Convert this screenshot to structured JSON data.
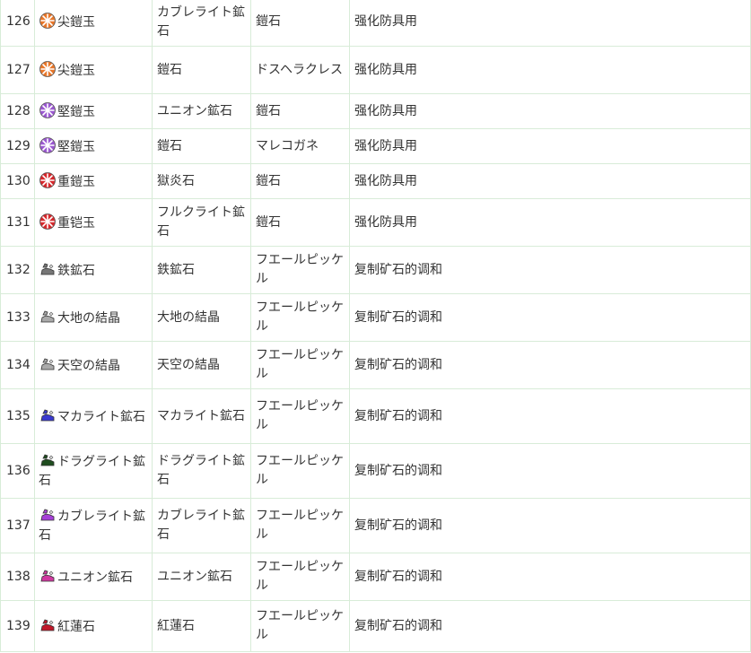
{
  "rows": [
    {
      "no": "126",
      "icon": "orange-spike-gem-icon",
      "icon_color": "#e8772a",
      "name": "尖鎧玉",
      "a": "カブレライト鉱石",
      "b": "鎧石",
      "use": "强化防具用",
      "h": 54
    },
    {
      "no": "127",
      "icon": "orange-spike-gem-icon",
      "icon_color": "#e8772a",
      "name": "尖鎧玉",
      "a": "鎧石",
      "b": "ドスヘラクレス",
      "use": "强化防具用",
      "h": 53
    },
    {
      "no": "128",
      "icon": "purple-spike-gem-icon",
      "icon_color": "#9b59d0",
      "name": "堅鎧玉",
      "a": "ユニオン鉱石",
      "b": "鎧石",
      "use": "强化防具用",
      "h": 39
    },
    {
      "no": "129",
      "icon": "purple-spike-gem-icon",
      "icon_color": "#9b59d0",
      "name": "堅鎧玉",
      "a": "鎧石",
      "b": "マレコガネ",
      "use": "强化防具用",
      "h": 39
    },
    {
      "no": "130",
      "icon": "red-spike-gem-icon",
      "icon_color": "#d6282c",
      "name": "重鎧玉",
      "a": "獄炎石",
      "b": "鎧石",
      "use": "强化防具用",
      "h": 39
    },
    {
      "no": "131",
      "icon": "red-spike-gem-icon",
      "icon_color": "#d6282c",
      "name": "重铠玉",
      "a": "フルクライト鉱石",
      "b": "鎧石",
      "use": "强化防具用",
      "h": 53
    },
    {
      "no": "132",
      "icon": "gray-ore-icon",
      "icon_color": "#777777",
      "name": "鉄鉱石",
      "a": "鉄鉱石",
      "b": "フエールピッケル",
      "use": "复制矿石的调和",
      "h": 53
    },
    {
      "no": "133",
      "icon": "light-gray-ore-icon",
      "icon_color": "#aaaaaa",
      "name": "大地の結晶",
      "a": "大地の結晶",
      "b": "フエールピッケル",
      "use": "复制矿石的调和",
      "h": 53
    },
    {
      "no": "134",
      "icon": "light-gray-ore-icon",
      "icon_color": "#aaaaaa",
      "name": "天空の結晶",
      "a": "天空の結晶",
      "b": "フエールピッケル",
      "use": "复制矿石的调和",
      "h": 53
    },
    {
      "no": "135",
      "icon": "blue-ore-icon",
      "icon_color": "#3a3ad0",
      "name": "マカライト鉱石",
      "a": "マカライト鉱石",
      "b": "フエールピッケル",
      "use": "复制矿石的调和",
      "h": 61
    },
    {
      "no": "136",
      "icon": "green-ore-icon",
      "icon_color": "#1f4d1f",
      "name": "ドラグライト鉱石",
      "a": "ドラグライト鉱石",
      "b": "フエールピッケル",
      "use": "复制矿石的调和",
      "h": 61
    },
    {
      "no": "137",
      "icon": "purple-ore-icon",
      "icon_color": "#a640d8",
      "name": "カブレライト鉱石",
      "a": "カブレライト鉱石",
      "b": "フエールピッケル",
      "use": "复制矿石的调和",
      "h": 61
    },
    {
      "no": "138",
      "icon": "pink-ore-icon",
      "icon_color": "#d03aa0",
      "name": "ユニオン鉱石",
      "a": "ユニオン鉱石",
      "b": "フエールピッケル",
      "use": "复制矿石的调和",
      "h": 53
    },
    {
      "no": "139",
      "icon": "red-ore-icon",
      "icon_color": "#c0182a",
      "name": "紅蓮石",
      "a": "紅蓮石",
      "b": "フエールピッケル",
      "use": "复制矿石的调和",
      "h": 57
    }
  ]
}
